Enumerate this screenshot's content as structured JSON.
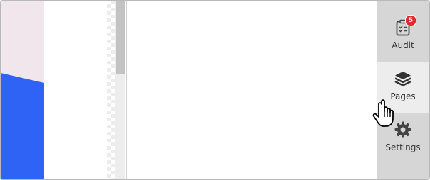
{
  "rail": {
    "audit": {
      "label": "Audit",
      "icon": "clipboard-checklist-icon",
      "badge": "5",
      "badge_color": "#e02b2b"
    },
    "pages": {
      "label": "Pages",
      "icon": "layers-icon",
      "state": "hovered"
    },
    "settings": {
      "label": "Settings",
      "icon": "gear-icon"
    }
  },
  "colors": {
    "left_pane_bg": "#f1e6ec",
    "blue_shape": "#2f63f5",
    "rail_bg": "#d6d6d6",
    "rail_hover_bg": "#ededed"
  }
}
